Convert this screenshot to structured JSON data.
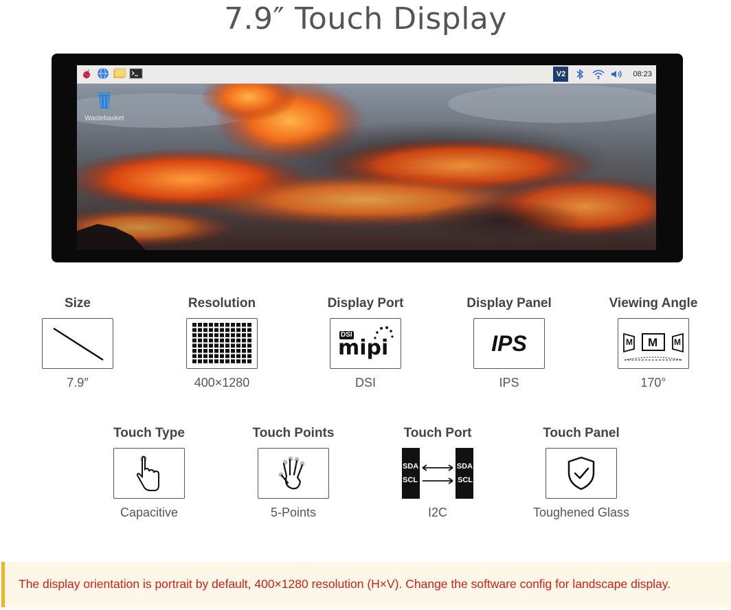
{
  "title": "7.9″ Touch Display",
  "desktop": {
    "wastebasket_label": "Wastebasket",
    "clock": "08:23",
    "vnc_label": "V2"
  },
  "specs": [
    {
      "heading": "Size",
      "value": "7.9″",
      "icon": "diagonal-line-icon"
    },
    {
      "heading": "Resolution",
      "value": "400×1280",
      "icon": "pixel-grid-icon"
    },
    {
      "heading": "Display Port",
      "value": "DSI",
      "icon": "mipi-dsi-logo",
      "logo_text_small": "DSI",
      "logo_text_big": "mipi"
    },
    {
      "heading": "Display Panel",
      "value": "IPS",
      "icon": "ips-text-icon",
      "logo_text": "IPS"
    },
    {
      "heading": "Viewing Angle",
      "value": "170°",
      "icon": "viewing-angle-icon",
      "logo_letter": "M"
    },
    {
      "heading": "Touch Type",
      "value": "Capacitive",
      "icon": "finger-touch-icon"
    },
    {
      "heading": "Touch Points",
      "value": "5-Points",
      "icon": "hand-five-points-icon"
    },
    {
      "heading": "Touch Port",
      "value": "I2C",
      "icon": "i2c-sda-scl-icon",
      "pin_a": "SDA",
      "pin_b": "SCL"
    },
    {
      "heading": "Touch Panel",
      "value": "Toughened Glass",
      "icon": "shield-check-icon"
    }
  ],
  "note": "The display orientation is portrait by default, 400×1280 resolution (H×V). Change the software config for landscape display.",
  "colors": {
    "note_text": "#d0201a",
    "note_border": "#f0b429",
    "note_bg": "#fcf7e6"
  }
}
